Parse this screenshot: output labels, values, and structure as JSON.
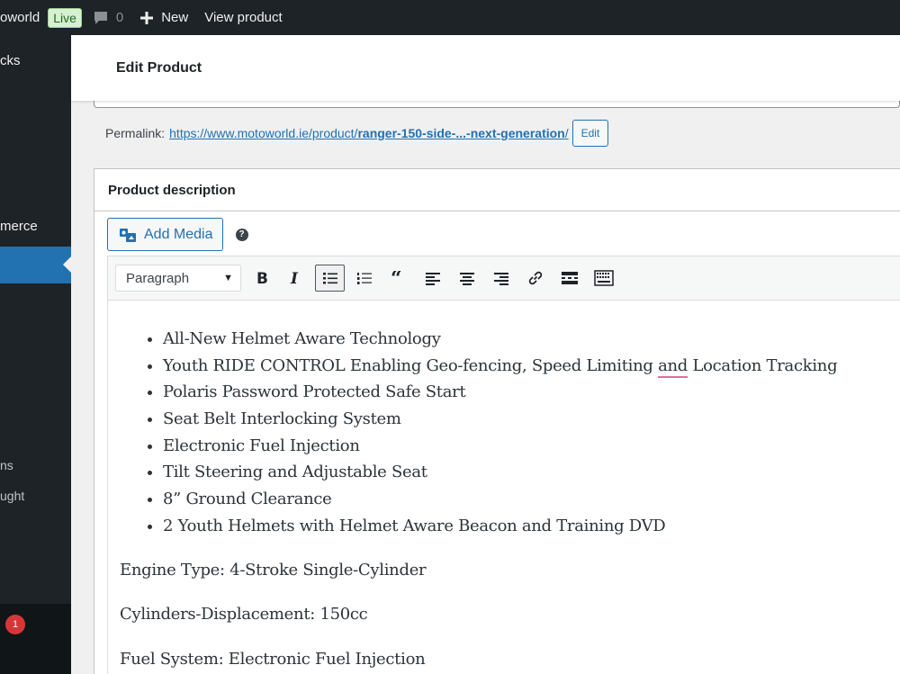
{
  "adminbar": {
    "site_name": "oworld",
    "live_badge": "Live",
    "comment_count": "0",
    "new_label": "New",
    "view_label": "View product"
  },
  "sidebar": {
    "items": [
      {
        "label": "cks"
      },
      {
        "label": "merce"
      },
      {
        "label": "ns"
      },
      {
        "label": "ught"
      }
    ],
    "badge": "1"
  },
  "header": {
    "title": "Edit Product"
  },
  "permalink": {
    "label": "Permalink:",
    "url_prefix": "https://www.motoworld.ie/product/",
    "slug": "ranger-150-side-...-next-generation",
    "url_suffix": "/",
    "edit_label": "Edit"
  },
  "postbox": {
    "title": "Product description",
    "add_media_label": "Add Media",
    "help_glyph": "?"
  },
  "toolbar": {
    "format_value": "Paragraph",
    "buttons": [
      "bold-icon",
      "italic-icon",
      "bullet-list-icon",
      "numbered-list-icon",
      "blockquote-icon",
      "align-left-icon",
      "align-center-icon",
      "align-right-icon",
      "link-icon",
      "read-more-icon",
      "toolbar-toggle-icon"
    ]
  },
  "content": {
    "bullets": [
      "All-New Helmet Aware Technology",
      "Youth RIDE CONTROL Enabling Geo-fencing, Speed Limiting ",
      "Polaris Password Protected Safe Start",
      "Seat Belt Interlocking System",
      "Electronic Fuel Injection",
      "Tilt Steering and Adjustable Seat",
      "8” Ground Clearance",
      "2 Youth Helmets with Helmet Aware Beacon and Training DVD"
    ],
    "bullet2_spell": "and",
    "bullet2_tail": " Location Tracking",
    "paragraphs": [
      "Engine Type: 4-Stroke Single-Cylinder",
      "Cylinders-Displacement: 150cc",
      "Fuel System: Electronic Fuel Injection"
    ]
  },
  "colors": {
    "admin_bar": "#1d2327",
    "accent": "#2271b1",
    "badge": "#d63638",
    "live_bg": "#d7f0d1"
  }
}
